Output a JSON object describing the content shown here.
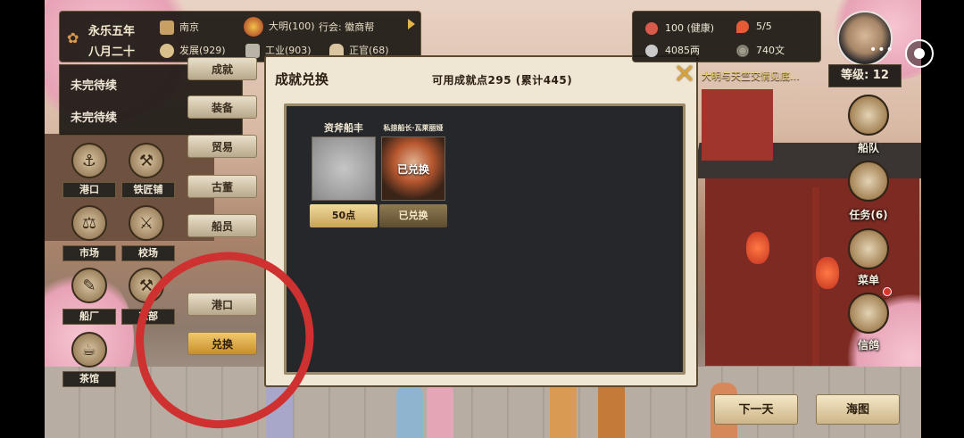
{
  "top_bar": {
    "date_year": "永乐五年",
    "date_month": "八月二十",
    "city": "南京",
    "development": "发展(929)",
    "nation": "大明(100)",
    "industry": "工业(903)",
    "guild": "行会: 徽商帮",
    "commerce": "正官(68)"
  },
  "stats": {
    "health": "100 (健康)",
    "energy": "5/5",
    "silver": "4085两",
    "copper": "740文"
  },
  "player": {
    "level_label": "等级: 12",
    "more_dots": "•••"
  },
  "ticker": "大明与天竺交情见底…",
  "pending": [
    "未完待续",
    "未完待续"
  ],
  "left_buttons": [
    {
      "label": "港口",
      "icon": "anchor-icon"
    },
    {
      "label": "铁匠铺",
      "icon": "anvil-icon"
    },
    {
      "label": "市场",
      "icon": "scale-icon"
    },
    {
      "label": "校场",
      "icon": "swords-icon"
    },
    {
      "label": "船厂",
      "icon": "wrench-icon"
    },
    {
      "label": "工部",
      "icon": "hammer-icon"
    },
    {
      "label": "茶馆",
      "icon": "teapot-icon"
    }
  ],
  "side_menu": [
    "成就",
    "装备",
    "贸易",
    "古董",
    "船员",
    "港口",
    "兑换"
  ],
  "dialog": {
    "title": "成就兑换",
    "points": "可用成就点295 (累计445)",
    "close_glyph": "✕",
    "items": [
      {
        "name": "资斧船丰",
        "button": "50点",
        "redeemed_overlay": ""
      },
      {
        "name": "私掠船长·瓦莱丽娅",
        "button": "已兑换",
        "redeemed_overlay": "已兑换"
      }
    ]
  },
  "right_menu": [
    {
      "label": "船队",
      "icon": "ship-icon"
    },
    {
      "label": "任务(6)",
      "icon": "compass-icon"
    },
    {
      "label": "菜单",
      "icon": "fan-icon"
    },
    {
      "label": "信鸽",
      "icon": "pigeon-icon"
    }
  ],
  "bottom": {
    "next_day": "下一天",
    "sea_map": "海图"
  },
  "colors": {
    "accent_gold": "#c88e2d",
    "annotation_red": "#cf3131"
  }
}
